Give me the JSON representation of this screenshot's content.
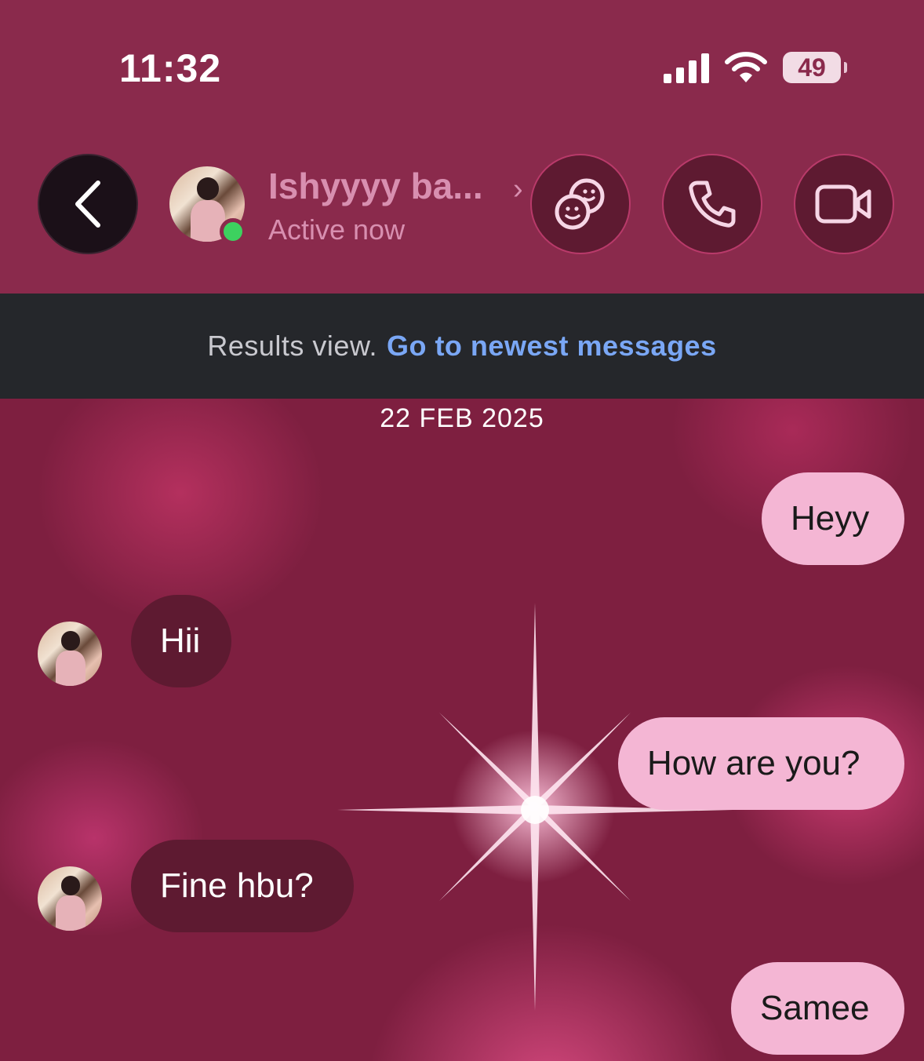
{
  "status_bar": {
    "time": "11:32",
    "battery": "49",
    "signal_icon": "cellular-signal-icon",
    "wifi_icon": "wifi-icon"
  },
  "header": {
    "back_icon": "chevron-left-icon",
    "contact_name": "Ishyyyy ba...",
    "contact_status": "Active now",
    "chevron": "›",
    "actions": [
      "sticker-icon",
      "phone-icon",
      "video-camera-icon"
    ]
  },
  "banner": {
    "text": "Results view.",
    "link": "Go to newest messages"
  },
  "chat": {
    "date": "22 FEB 2025",
    "messages": [
      {
        "direction": "outgoing",
        "text": "Heyy"
      },
      {
        "direction": "incoming",
        "text": "Hii"
      },
      {
        "direction": "outgoing",
        "text": "How are you?"
      },
      {
        "direction": "incoming",
        "text": "Fine hbu?"
      },
      {
        "direction": "outgoing",
        "text": "Samee"
      }
    ]
  },
  "colors": {
    "header_bg": "#8a2a4c",
    "banner_bg": "#25272b",
    "link": "#7aa7f5",
    "outgoing_bubble": "#f4b6d4",
    "incoming_bubble": "#5e1a31",
    "online": "#3dd15f"
  }
}
